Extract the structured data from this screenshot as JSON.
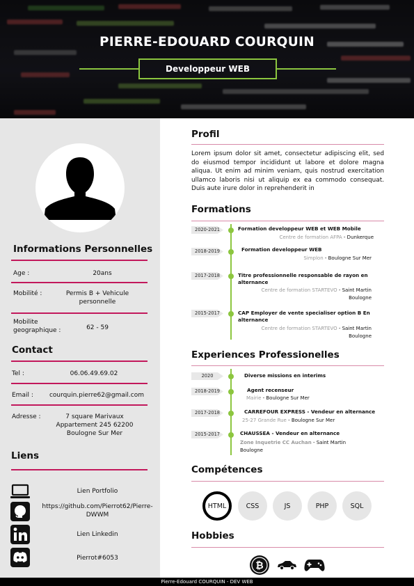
{
  "header": {
    "name": "PIERRE-EDOUARD COURQUIN",
    "title": "Developpeur WEB",
    "accent": "#8cc63f"
  },
  "personal": {
    "heading": "Informations Personnelles",
    "items": [
      {
        "label": "Age :",
        "value": "20ans"
      },
      {
        "label": "Mobilité :",
        "value": "Permis B + Vehicule personnelle"
      },
      {
        "label": "Mobilite geographique :",
        "value": "62 - 59"
      }
    ]
  },
  "contact": {
    "heading": "Contact",
    "items": [
      {
        "label": "Tel :",
        "value": "06.06.49.69.02"
      },
      {
        "label": "Email :",
        "value": "courquin.pierre62@gmail.com"
      },
      {
        "label": "Adresse :",
        "value": "7 square Marivaux Appartement 245 62200 Boulogne Sur Mer"
      }
    ]
  },
  "links": {
    "heading": "Liens",
    "items": [
      {
        "icon": "laptop-icon",
        "text": "Lien Portfolio"
      },
      {
        "icon": "github-icon",
        "text": "https://github.com/Pierrot62/Pierre-DWWM"
      },
      {
        "icon": "linkedin-icon",
        "text": "Lien Linkedin"
      },
      {
        "icon": "discord-icon",
        "text": "Pierrot#6053"
      }
    ]
  },
  "profil": {
    "heading": "Profil",
    "text": "Lorem ipsum dolor sit amet, consectetur adipiscing elit, sed do eiusmod tempor incididunt ut labore et dolore magna aliqua. Ut enim ad minim veniam, quis nostrud exercitation ullamco laboris nisi ut aliquip ex ea commodo consequat. Duis aute irure dolor in reprehenderit in"
  },
  "formations": {
    "heading": "Formations",
    "items": [
      {
        "date": "2020-2021",
        "title": "Formation developpeur WEB et WEB Mobile",
        "place": "Centre de formation AFPA",
        "city": " - Dunkerque"
      },
      {
        "date": "2018-2019",
        "title": "Formation developpeur WEB",
        "place": "Simplon",
        "city": " - Boulogne Sur Mer"
      },
      {
        "date": "2017-2018",
        "title": "Titre professionnelle responsable de rayon en alternance",
        "place": "Centre de formation STARTEVO",
        "city": " - Saint Martin Boulogne"
      },
      {
        "date": "2015-2017",
        "title": "CAP Employer de vente specialiser option B En alternance",
        "place": "Centre de formation STARTEVO",
        "city": " - Saint Martin Boulogne"
      }
    ]
  },
  "experiences": {
    "heading": "Experiences Professionelles",
    "items": [
      {
        "date": "2020",
        "title": "Diverse missions en interims",
        "place": "",
        "city": ""
      },
      {
        "date": "2018-2019",
        "title": "Agent recenseur",
        "place": "Mairie",
        "city": " - Boulogne Sur Mer"
      },
      {
        "date": "2017-2018",
        "title": "CARREFOUR EXPRESS - Vendeur en alternance",
        "place": "25-27 Grande Rue",
        "city": " - Boulogne Sur Mer"
      },
      {
        "date": "2015-2017",
        "title": "CHAUSSEA - Vendeur en alternance",
        "place": "Zone Inquetrie CC Auchan",
        "city": " - Saint Martin Boulogne"
      }
    ]
  },
  "competences": {
    "heading": "Compétences",
    "items": [
      "HTML",
      "CSS",
      "JS",
      "PHP",
      "SQL"
    ]
  },
  "hobbies": {
    "heading": "Hobbies",
    "items": [
      "bitcoin-icon",
      "car-icon",
      "gamepad-icon"
    ]
  },
  "footer": {
    "text": "Pierre-Edouard COURQUIN - DEV WEB"
  }
}
